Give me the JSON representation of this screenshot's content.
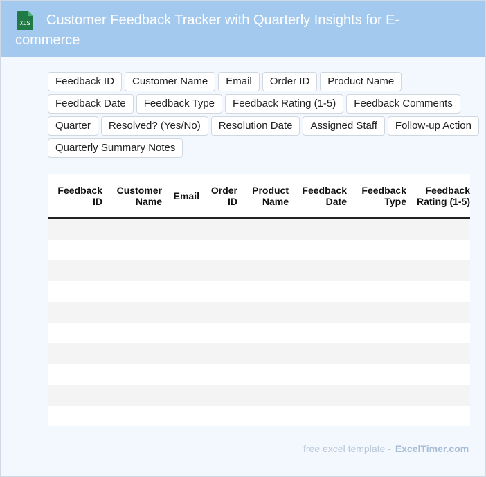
{
  "header": {
    "title": "Customer Feedback Tracker with Quarterly Insights for E-commerce",
    "icon_label": "XLS",
    "icon_color": "#1f7a45",
    "background": "#a3c9ef"
  },
  "fields": [
    "Feedback ID",
    "Customer Name",
    "Email",
    "Order ID",
    "Product Name",
    "Feedback Date",
    "Feedback Type",
    "Feedback Rating (1-5)",
    "Feedback Comments",
    "Quarter",
    "Resolved? (Yes/No)",
    "Resolution Date",
    "Assigned Staff",
    "Follow-up Action",
    "Quarterly Summary Notes"
  ],
  "table": {
    "columns": [
      {
        "line1": "Feedback",
        "line2": "ID"
      },
      {
        "line1": "Customer",
        "line2": "Name"
      },
      {
        "line1": "Email",
        "line2": ""
      },
      {
        "line1": "Order",
        "line2": "ID"
      },
      {
        "line1": "Product",
        "line2": "Name"
      },
      {
        "line1": "Feedback",
        "line2": "Date"
      },
      {
        "line1": "Feedback",
        "line2": "Type"
      },
      {
        "line1": "Feedback",
        "line2": "Rating (1-5)"
      }
    ],
    "empty_rows": 10
  },
  "footer": {
    "text": "free excel template -",
    "brand": "ExcelTimer.com"
  }
}
